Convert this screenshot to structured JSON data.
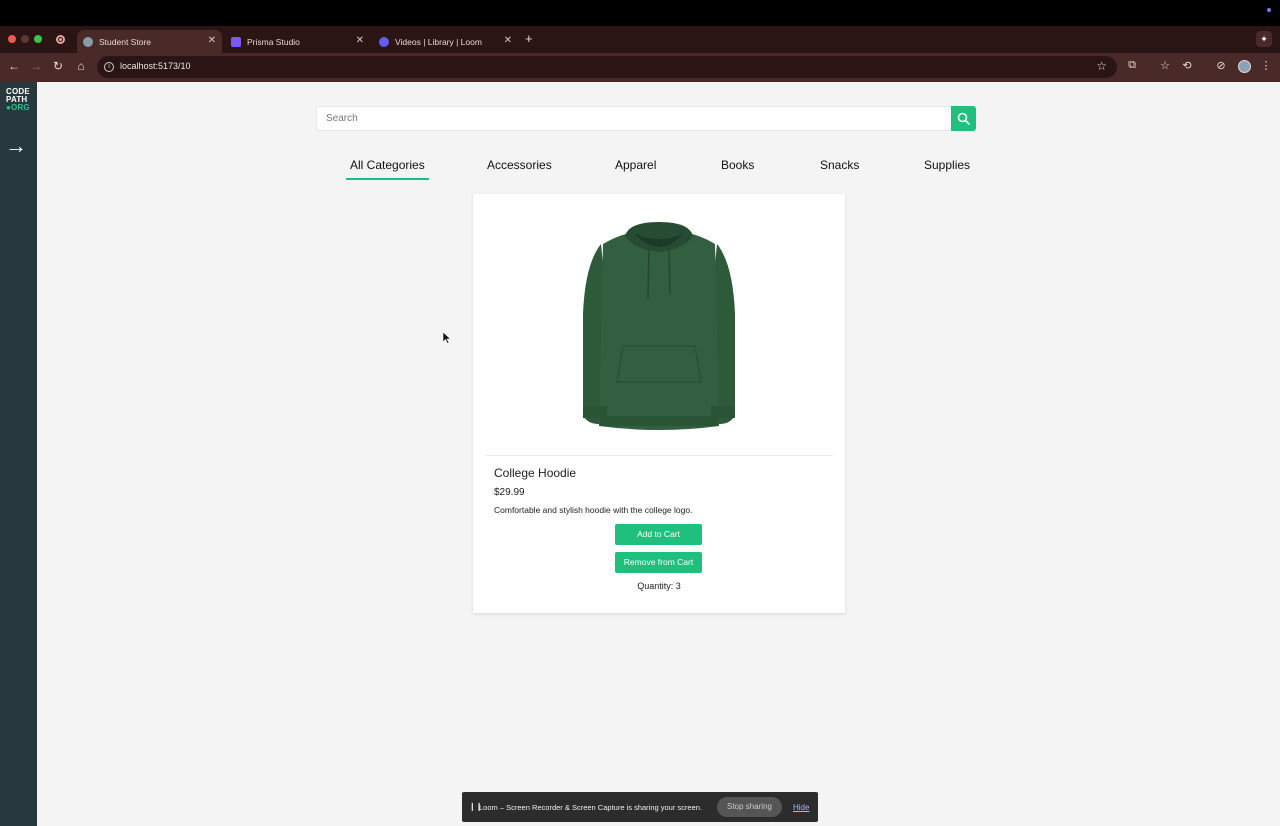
{
  "browser": {
    "tabs": [
      {
        "title": "Student Store",
        "favicon_color": "#8a9aa8",
        "active": true
      },
      {
        "title": "Prisma Studio",
        "favicon_color": "#7a5cf0",
        "active": false
      },
      {
        "title": "Videos | Library | Loom",
        "favicon_color": "#625df5",
        "active": false
      }
    ],
    "new_tab_label": "+",
    "url": "localhost:5173/10"
  },
  "sidebar": {
    "logo_lines": [
      "CODE",
      "PATH",
      "●ORG"
    ],
    "expand_icon": "arrow-right-icon"
  },
  "search": {
    "placeholder": "Search"
  },
  "categories": [
    {
      "label": "All Categories",
      "active": true
    },
    {
      "label": "Accessories",
      "active": false
    },
    {
      "label": "Apparel",
      "active": false
    },
    {
      "label": "Books",
      "active": false
    },
    {
      "label": "Snacks",
      "active": false
    },
    {
      "label": "Supplies",
      "active": false
    }
  ],
  "product": {
    "name": "College Hoodie",
    "price": "$29.99",
    "description": "Comfortable and stylish hoodie with the college logo.",
    "add_label": "Add to Cart",
    "remove_label": "Remove from Cart",
    "quantity_text": "Quantity: 3",
    "image_color": "#2f5f3c"
  },
  "loom": {
    "message": "Loom – Screen Recorder & Screen Capture is sharing your screen.",
    "stop_label": "Stop sharing",
    "hide_label": "Hide"
  },
  "colors": {
    "accent": "#1fbf7e",
    "sidebar": "#27393f",
    "browser_frame": "#4a2a28"
  }
}
